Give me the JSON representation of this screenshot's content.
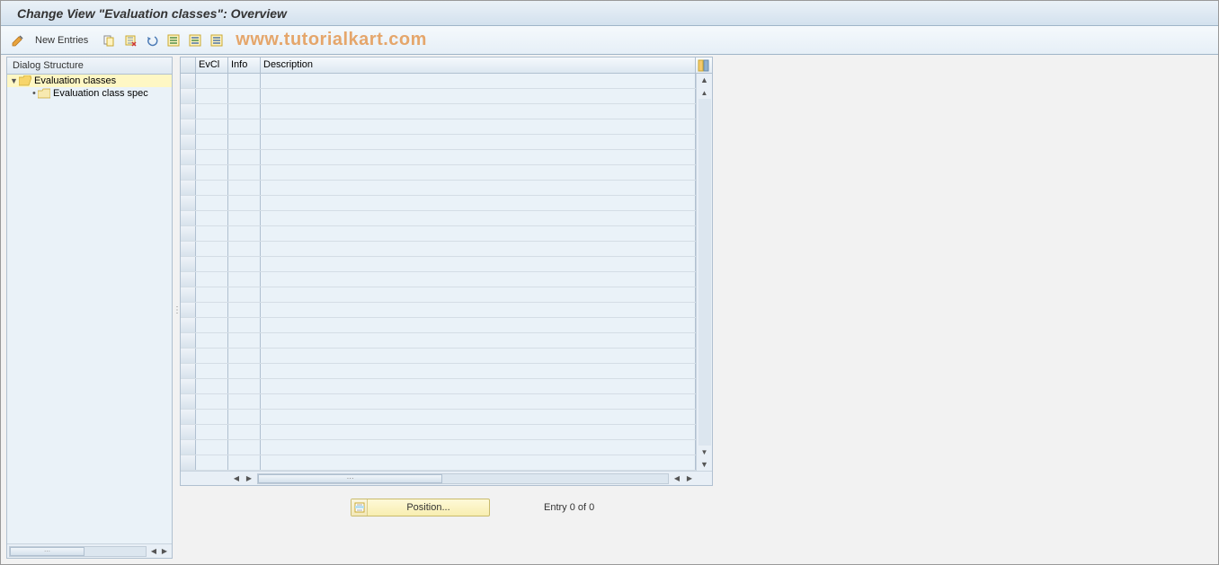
{
  "title": "Change View \"Evaluation classes\": Overview",
  "toolbar": {
    "new_entries_label": "New Entries"
  },
  "watermark": "www.tutorialkart.com",
  "tree": {
    "header": "Dialog Structure",
    "items": [
      {
        "label": "Evaluation classes",
        "selected": true,
        "open": true
      },
      {
        "label": "Evaluation class spec",
        "selected": false,
        "child": true
      }
    ]
  },
  "table": {
    "columns": {
      "evcl": "EvCl",
      "info": "Info",
      "desc": "Description"
    },
    "rows": []
  },
  "footer": {
    "position_label": "Position...",
    "entry_text": "Entry 0 of 0"
  }
}
